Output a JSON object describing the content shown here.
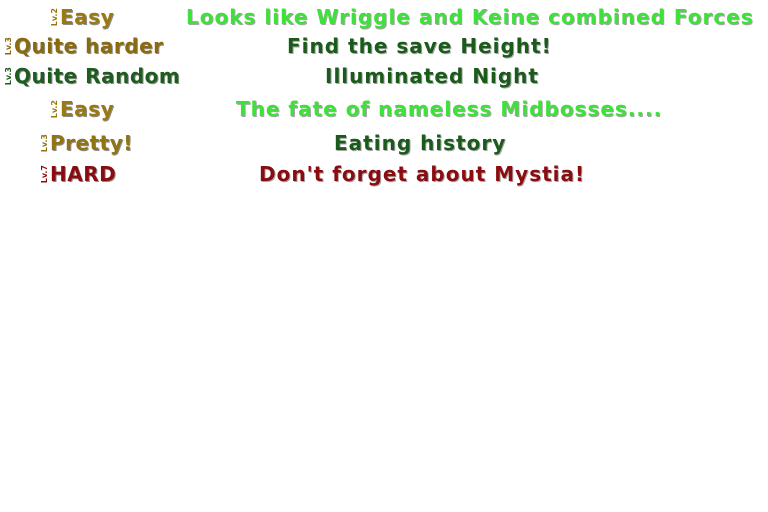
{
  "colors": {
    "easy": "#9a7a10",
    "quite_harder": "#8a6a0e",
    "quite_random": "#1f5c1f",
    "pretty": "#8f7414",
    "hard": "#8a0c10",
    "title_bright_green": "#3ee03a",
    "title_dark_green": "#1a5a1a",
    "title_dark_red": "#8a0c10"
  },
  "rows": [
    {
      "level_tag": "Lv.2",
      "difficulty": "Easy",
      "title": "Looks like Wriggle and Keine combined Forces"
    },
    {
      "level_tag": "Lv.3",
      "difficulty": "Quite harder",
      "title": "Find the save Height!"
    },
    {
      "level_tag": "Lv.3",
      "difficulty": "Quite Random",
      "title": "Illuminated Night"
    },
    {
      "level_tag": "Lv.2",
      "difficulty": "Easy",
      "title": "The fate of nameless Midbosses...."
    },
    {
      "level_tag": "Lv.3",
      "difficulty": "Pretty!",
      "title": "Eating history"
    },
    {
      "level_tag": "Lv.7",
      "difficulty": "HARD",
      "title": "Don't forget about Mystia!"
    }
  ]
}
